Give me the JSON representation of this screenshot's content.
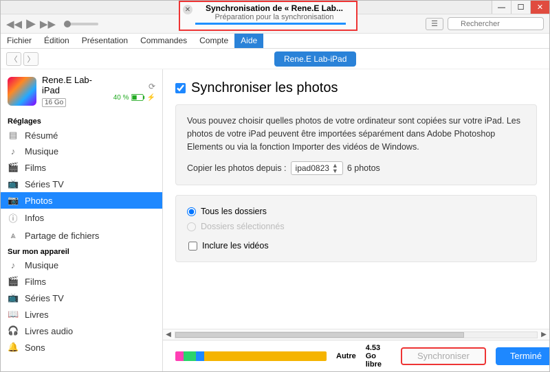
{
  "window": {
    "search_placeholder": "Rechercher"
  },
  "sync_banner": {
    "title": "Synchronisation de « Rene.E Lab...",
    "subtitle": "Préparation pour la synchronisation"
  },
  "menu": {
    "items": [
      "Fichier",
      "Édition",
      "Présentation",
      "Commandes",
      "Compte",
      "Aide"
    ],
    "selected_index": 5
  },
  "device_pill": "Rene.E Lab-iPad",
  "device": {
    "name": "Rene.E Lab-iPad",
    "capacity": "16 Go",
    "battery_pct": "40 %"
  },
  "sidebar": {
    "settings_header": "Réglages",
    "settings": [
      {
        "label": "Résumé"
      },
      {
        "label": "Musique"
      },
      {
        "label": "Films"
      },
      {
        "label": "Séries TV"
      },
      {
        "label": "Photos",
        "selected": true
      },
      {
        "label": "Infos"
      },
      {
        "label": "Partage de fichiers"
      }
    ],
    "device_header": "Sur mon appareil",
    "device_items": [
      {
        "label": "Musique"
      },
      {
        "label": "Films"
      },
      {
        "label": "Séries TV"
      },
      {
        "label": "Livres"
      },
      {
        "label": "Livres audio"
      },
      {
        "label": "Sons"
      }
    ]
  },
  "main": {
    "section_title": "Synchroniser les photos",
    "desc": "Vous pouvez choisir quelles photos de votre ordinateur sont copiées sur votre iPad. Les photos de votre iPad peuvent être importées séparément dans Adobe Photoshop Elements ou via la fonction Importer des vidéos de Windows.",
    "copy_label": "Copier les photos depuis :",
    "copy_source": "ipad0823",
    "copy_count": "6 photos",
    "opt_all": "Tous les dossiers",
    "opt_selected": "Dossiers sélectionnés",
    "opt_videos": "Inclure les vidéos"
  },
  "footer": {
    "storage_segments": [
      {
        "color": "#ff3fb4",
        "flex": 4
      },
      {
        "color": "#2bd36b",
        "flex": 6
      },
      {
        "color": "#1e88ff",
        "flex": 4
      },
      {
        "color": "#f5b400",
        "flex": 60
      }
    ],
    "storage_cat": "Autre",
    "storage_free": "4.53 Go libre",
    "sync_btn": "Synchroniser",
    "done_btn": "Terminé"
  }
}
